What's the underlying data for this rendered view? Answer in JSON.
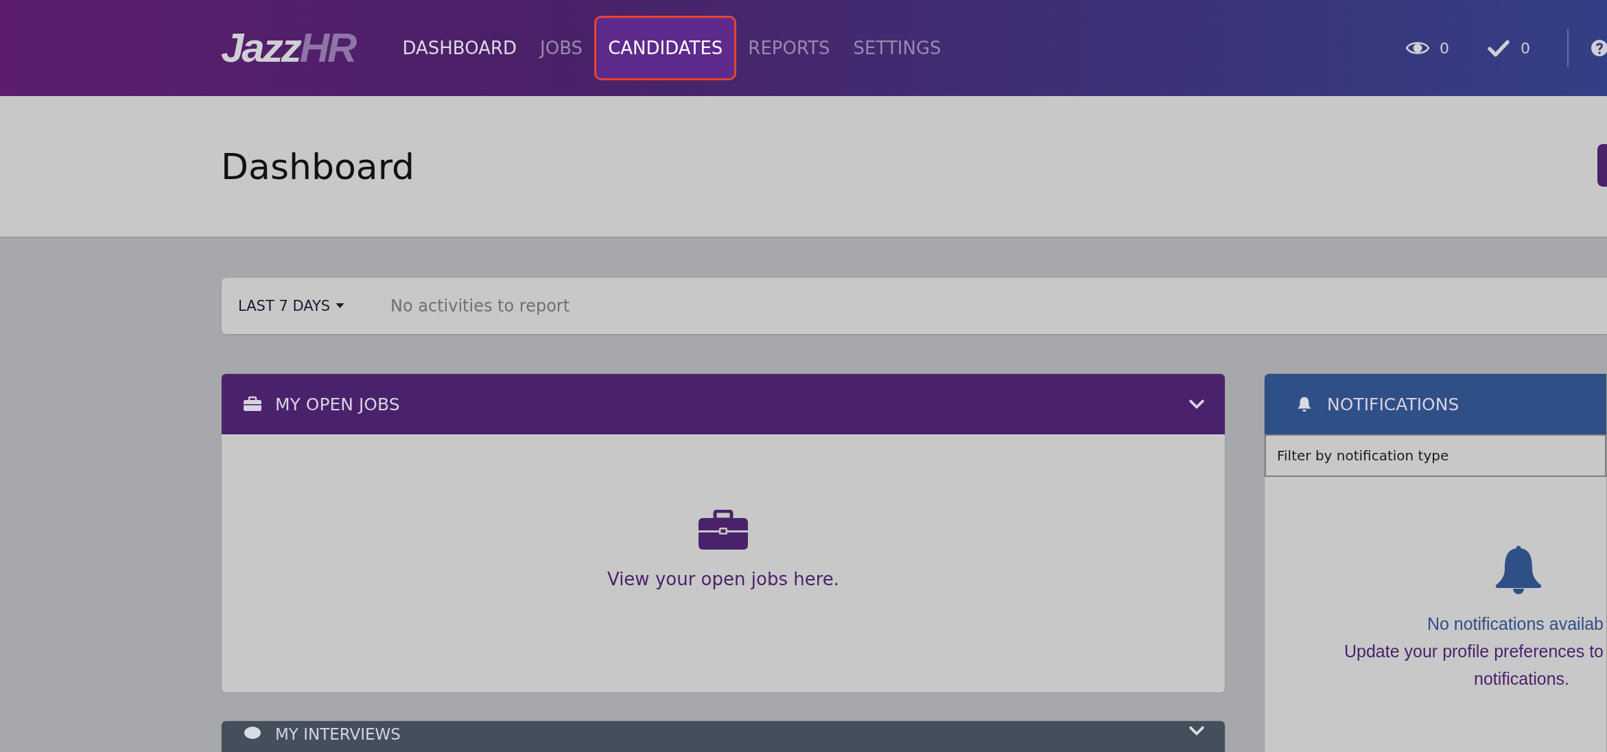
{
  "nav": {
    "logo": {
      "main": "Jazz",
      "accent": "HR"
    },
    "items": [
      {
        "label": "DASHBOARD",
        "selected": false,
        "dim": false
      },
      {
        "label": "JOBS",
        "selected": false,
        "dim": true
      },
      {
        "label": "CANDIDATES",
        "selected": true,
        "dim": false
      },
      {
        "label": "REPORTS",
        "selected": false,
        "dim": true
      },
      {
        "label": "SETTINGS",
        "selected": false,
        "dim": true
      }
    ],
    "counters": [
      {
        "kind": "views",
        "count": "0"
      },
      {
        "kind": "checks",
        "count": "0"
      }
    ]
  },
  "page_title": "Dashboard",
  "activity": {
    "range": "LAST 7 DAYS",
    "message": "No activities to report"
  },
  "jobs_panel": {
    "title": "MY OPEN JOBS",
    "empty_text": "View your open jobs here."
  },
  "notifications_panel": {
    "title": "NOTIFICATIONS",
    "filter": {
      "placeholder": "Filter by notification type"
    },
    "lines": [
      "No notifications availab",
      "Update your profile preferences to",
      "notifications."
    ]
  },
  "interviews_panel": {
    "title": "MY INTERVIEWS"
  }
}
